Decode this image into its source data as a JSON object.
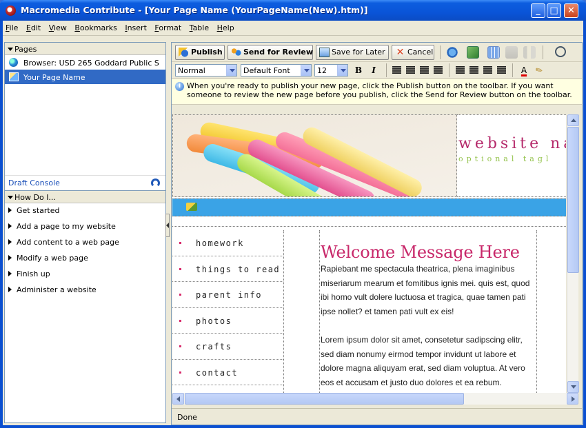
{
  "window": {
    "title": "Macromedia Contribute - [Your Page Name (YourPageName(New).htm)]",
    "minimize": "_",
    "maximize": "□",
    "close": "✕"
  },
  "menu": [
    "File",
    "Edit",
    "View",
    "Bookmarks",
    "Insert",
    "Format",
    "Table",
    "Help"
  ],
  "pages_panel": {
    "header": "Pages",
    "items": [
      {
        "label": "Browser: USD 265 Goddard Public S",
        "icon": "globe-icon"
      },
      {
        "label": "Your Page Name",
        "icon": "page-icon",
        "selected": true
      }
    ],
    "draft_console": "Draft Console"
  },
  "howdo_panel": {
    "header": "How Do I...",
    "items": [
      "Get started",
      "Add a page to my website",
      "Add content to a web page",
      "Modify a web page",
      "Finish up",
      "Administer a website"
    ]
  },
  "toolbar": {
    "publish": "Publish",
    "send_review": "Send for Review",
    "save_later": "Save for Later",
    "cancel": "Cancel"
  },
  "format_bar": {
    "style": "Normal",
    "font": "Default Font",
    "size": "12",
    "bold": "B",
    "italic": "I",
    "text_color": "A"
  },
  "info_message": "When you're ready to publish your new page, click the Publish button on the toolbar. If you want someone to review the new page before you publish, click the Send for Review button on the toolbar.",
  "page": {
    "site_title": "website na",
    "site_tagline": "optional tagl",
    "nav": [
      "homework",
      "things to read",
      "parent info",
      "photos",
      "crafts",
      "contact"
    ],
    "welcome": "Welcome Message Here",
    "paragraphs": [
      "Rapiebant me spectacula theatrica, plena imaginibus miseriarum mearum et fomitibus ignis mei. quis est, quod ibi homo vult dolere luctuosa et tragica, quae tamen pati ipse nollet? et tamen pati vult ex eis!",
      "Lorem ipsum dolor sit amet, consetetur sadipscing elitr, sed diam nonumy eirmod tempor invidunt ut labore et dolore magna aliquyam erat, sed diam voluptua. At vero eos et accusam et justo duo dolores et ea rebum."
    ]
  },
  "status": "Done",
  "colors": {
    "accent_pink": "#c8286a",
    "nav_blue_bar": "#3aa3e6",
    "selection": "#316ac5",
    "tagline_green": "#93c24a"
  }
}
